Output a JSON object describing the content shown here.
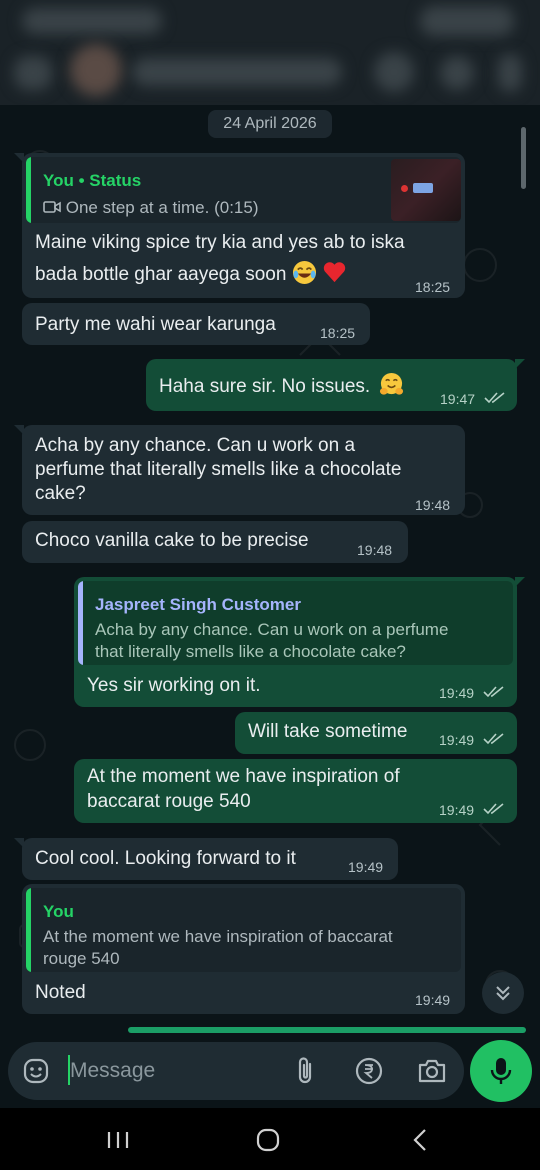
{
  "chat": {
    "date": "24 April 2026"
  },
  "messages": [
    {
      "direction": "in",
      "reply": {
        "author": "You • Status",
        "text": "One step at a time. (0:15)"
      },
      "lines": [
        "Maine viking spice try kia and yes ab to iska",
        "bada bottle ghar aayega soon"
      ],
      "time": "18:25"
    },
    {
      "direction": "in",
      "text": "Party me wahi wear karunga",
      "time": "18:25"
    },
    {
      "direction": "out",
      "text": "Haha sure sir. No issues.",
      "time": "19:47"
    },
    {
      "direction": "in",
      "lines": [
        "Acha by any chance. Can u work on a",
        "perfume that literally smells like a chocolate",
        "cake?"
      ],
      "time": "19:48"
    },
    {
      "direction": "in",
      "text": "Choco vanilla cake to be precise",
      "time": "19:48"
    },
    {
      "direction": "out",
      "reply": {
        "author": "Jaspreet Singh Customer",
        "lines": [
          "Acha by any chance. Can u work on a perfume",
          "that literally smells like a chocolate cake?"
        ]
      },
      "text": "Yes sir working on it.",
      "time": "19:49"
    },
    {
      "direction": "out",
      "text": "Will take sometime",
      "time": "19:49"
    },
    {
      "direction": "out",
      "lines": [
        "At the moment we have inspiration of",
        "baccarat rouge 540"
      ],
      "time": "19:49"
    },
    {
      "direction": "in",
      "text": "Cool cool. Looking forward to it",
      "time": "19:49"
    },
    {
      "direction": "in",
      "reply": {
        "author": "You",
        "lines": [
          "At the moment we have inspiration of baccarat",
          "rouge 540"
        ]
      },
      "text": "Noted",
      "time": "19:49"
    }
  ],
  "composer": {
    "placeholder": "Message"
  },
  "colors": {
    "outgoing_bubble": "#134d37",
    "incoming_bubble": "#1f2c33",
    "accent_green": "#25d366",
    "reply_author_you": "#25d366",
    "reply_author_contact": "#a5b4fc"
  }
}
